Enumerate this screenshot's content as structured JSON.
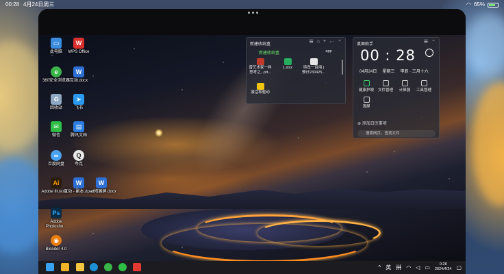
{
  "ipad_status": {
    "time": "00:28",
    "date": "4月24日周三",
    "battery_percent": "65%",
    "battery_level": 0.65
  },
  "desktop_icons": [
    {
      "label": "此电脑",
      "icon": "computer-icon",
      "color": "#3a8dde"
    },
    {
      "label": "WPS Office",
      "icon": "wps-icon",
      "color": "#d9302c"
    },
    {
      "label": "360安全浏览器",
      "icon": "360-browser-icon",
      "color": "#3bb54a"
    },
    {
      "label": "互动.docx",
      "icon": "docx-icon",
      "color": "#2e6fd4"
    },
    {
      "label": "回收站",
      "icon": "recycle-bin-icon",
      "color": "#8fa8c4"
    },
    {
      "label": "飞书",
      "icon": "feishu-icon",
      "color": "#2b9af0"
    },
    {
      "label": "微信",
      "icon": "wechat-icon",
      "color": "#2fbf46"
    },
    {
      "label": "腾讯文档",
      "icon": "tencent-docs-icon",
      "color": "#2a7de1"
    },
    {
      "label": "百度网盘",
      "icon": "baidu-netdisk-icon",
      "color": "#4aa3f0"
    },
    {
      "label": "夸克",
      "icon": "quark-icon",
      "color": "#e8e8e8"
    },
    {
      "label": "Adobe Illustrat...",
      "icon": "illustrator-icon",
      "color": "#2b1d0e"
    },
    {
      "label": "互动 - 副本.docx",
      "icon": "docx-icon",
      "color": "#2e6fd4"
    },
    {
      "label": "ipad拓展屏.docx",
      "icon": "docx-icon",
      "color": "#2e6fd4"
    },
    {
      "label": "Adobe Photosho...",
      "icon": "photoshop-icon",
      "color": "#0b2a44"
    },
    {
      "label": "Blender 4.0",
      "icon": "blender-icon",
      "color": "#e87d0d"
    }
  ],
  "favorites": {
    "title": "新建收纳盒",
    "section_label": "新建收纳盒",
    "items": [
      {
        "label": "曾艺术家一样思考之...pd...",
        "color": "#c0392b"
      },
      {
        "label": "1.xlsx",
        "color": "#27ae60"
      },
      {
        "label": "待改一目用 | 预计230425...",
        "color": "#e6e6e6"
      },
      {
        "label": "app",
        "color": "#ffffff"
      },
      {
        "label": "激活和驱动",
        "color": "#f1c40f"
      }
    ]
  },
  "assistant": {
    "title": "桌面助手",
    "clock": "00 : 28",
    "date": "04月24日",
    "weekday": "星期三",
    "lunar": "甲辰 · 三月十六",
    "tools": [
      {
        "label": "健康护眼",
        "icon": "eye-care-icon"
      },
      {
        "label": "文件管理",
        "icon": "folder-icon"
      },
      {
        "label": "计算器",
        "icon": "calculator-icon"
      },
      {
        "label": "工具管理",
        "icon": "toolbox-icon"
      },
      {
        "label": "清屏",
        "icon": "clean-screen-icon"
      }
    ],
    "add_event": "添加日历事项",
    "search_placeholder": "搜索网页、查找文件"
  },
  "taskbar": {
    "apps": [
      {
        "name": "windows-start",
        "color": "#3aa0f0"
      },
      {
        "name": "app-colorful",
        "color": "#f0b42a"
      },
      {
        "name": "file-explorer",
        "color": "#f5c542"
      },
      {
        "name": "edge-browser",
        "color": "#1e90d6"
      },
      {
        "name": "360-browser",
        "color": "#3bb54a"
      },
      {
        "name": "wechat",
        "color": "#2fbf46"
      },
      {
        "name": "wps",
        "color": "#e23a32"
      }
    ],
    "ime_en": "英",
    "ime_pinyin": "拼",
    "time": "0:28",
    "date": "2024/4/24"
  }
}
